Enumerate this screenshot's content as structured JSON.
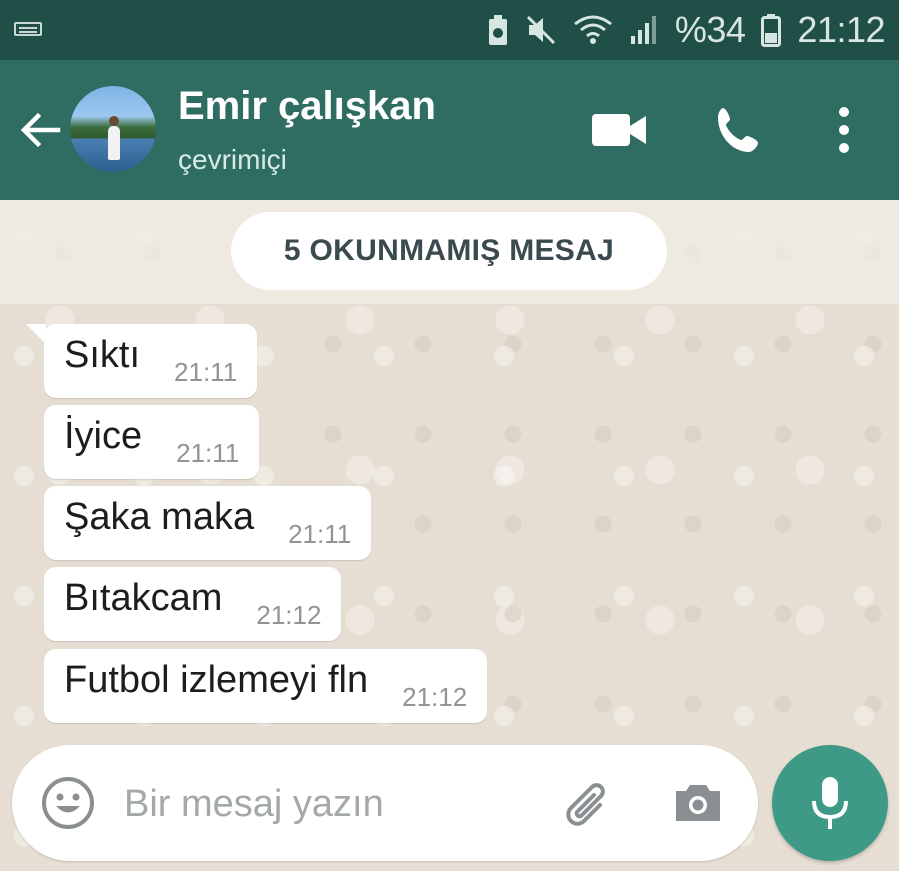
{
  "status_bar": {
    "battery_percent": "%34",
    "clock": "21:12",
    "icons": [
      "keyboard-icon",
      "battery-saver-icon",
      "mute-icon",
      "wifi-icon",
      "signal-icon",
      "battery-icon"
    ]
  },
  "header": {
    "contact_name": "Emir çalışkan",
    "contact_status": "çevrimiçi",
    "icons": [
      "back-arrow-icon",
      "video-call-icon",
      "phone-icon",
      "more-vert-icon"
    ]
  },
  "chat": {
    "unread_banner": "5 OKUNMAMIŞ MESAJ",
    "messages": [
      {
        "text": "Sıktı",
        "time": "21:11"
      },
      {
        "text": "İyice",
        "time": "21:11"
      },
      {
        "text": "Şaka maka",
        "time": "21:11"
      },
      {
        "text": "Bıtakcam",
        "time": "21:12"
      },
      {
        "text": "Futbol izlemeyi fln",
        "time": "21:12"
      }
    ]
  },
  "composer": {
    "placeholder": "Bir mesaj yazın",
    "value": "",
    "icons": [
      "emoji-icon",
      "paperclip-icon",
      "camera-icon",
      "microphone-icon"
    ]
  },
  "colors": {
    "status_bar": "#1f4f47",
    "app_bar": "#2f6d63",
    "chat_background": "#e6ded3",
    "accent": "#3e9a86",
    "bubble": "#ffffff"
  }
}
